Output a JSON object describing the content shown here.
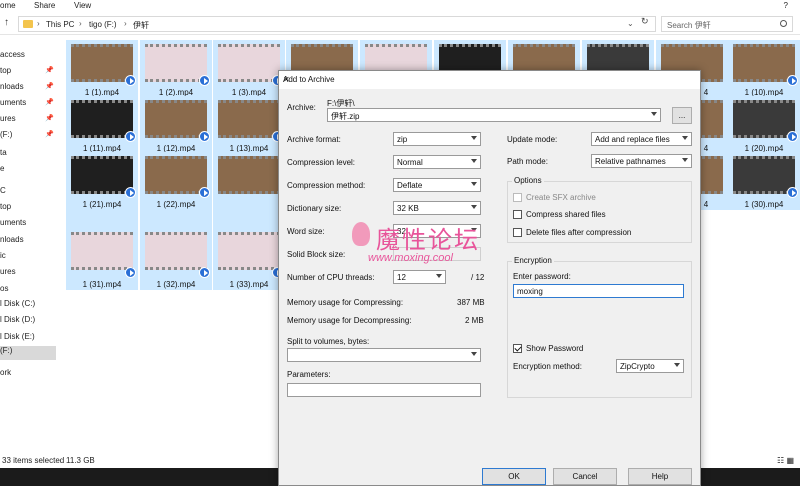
{
  "ribbon": {
    "tabs": [
      "ome",
      "Share",
      "View"
    ]
  },
  "address": {
    "crumbs": [
      "This PC",
      "tigo (F:)",
      "伊轩"
    ],
    "search_placeholder": "Search 伊轩"
  },
  "sidebar": {
    "items": [
      {
        "label": "access",
        "pinned": false
      },
      {
        "label": "top",
        "pinned": true
      },
      {
        "label": "nloads",
        "pinned": true
      },
      {
        "label": "uments",
        "pinned": true
      },
      {
        "label": "ures",
        "pinned": true
      },
      {
        "label": "(F:)",
        "pinned": true
      },
      {
        "label": "ta",
        "pinned": false
      },
      {
        "label": "e",
        "pinned": false
      },
      {
        "label": "C",
        "pinned": false
      },
      {
        "label": "top",
        "pinned": false
      },
      {
        "label": "uments",
        "pinned": false
      },
      {
        "label": "nloads",
        "pinned": false
      },
      {
        "label": "ic",
        "pinned": false
      },
      {
        "label": "ures",
        "pinned": false
      },
      {
        "label": "os",
        "pinned": false
      },
      {
        "label": "l Disk (C:)",
        "pinned": false
      },
      {
        "label": "l Disk (D:)",
        "pinned": false
      },
      {
        "label": "l Disk (E:)",
        "pinned": false
      },
      {
        "label": "(F:)",
        "pinned": false,
        "selected": true
      },
      {
        "label": "ork",
        "pinned": false
      }
    ]
  },
  "files": [
    {
      "name": "1 (1).mp4"
    },
    {
      "name": "1 (2).mp4"
    },
    {
      "name": "1 (3).mp4"
    },
    {
      "name": "1 (10).mp4"
    },
    {
      "name": "1 (11).mp4"
    },
    {
      "name": "1 (12).mp4"
    },
    {
      "name": "1 (13).mp4"
    },
    {
      "name": "1 (20).mp4"
    },
    {
      "name": "1 (21).mp4"
    },
    {
      "name": "1 (22).mp4"
    },
    {
      "name": "1 (30).mp4"
    },
    {
      "name": "1 (31).mp4"
    },
    {
      "name": "1 (32).mp4"
    },
    {
      "name": "1 (33).mp4"
    },
    {
      "name": "4"
    },
    {
      "name": "4"
    },
    {
      "name": "4"
    }
  ],
  "status": {
    "selection": "33 items selected",
    "size": "11.3 GB"
  },
  "dialog": {
    "title": "Add to Archive",
    "archive_label": "Archive:",
    "archive_path": "F:\\伊轩\\",
    "archive_name": "伊轩.zip",
    "browse_label": "...",
    "left_fields": [
      {
        "label": "Archive format:",
        "value": "zip"
      },
      {
        "label": "Compression level:",
        "value": "Normal"
      },
      {
        "label": "Compression method:",
        "value": "Deflate"
      },
      {
        "label": "Dictionary size:",
        "value": "32 KB"
      },
      {
        "label": "Word size:",
        "value": "32"
      },
      {
        "label": "Solid Block size:",
        "value": ""
      }
    ],
    "threads_label": "Number of CPU threads:",
    "threads_value": "12",
    "threads_max": "/ 12",
    "mem_compress_label": "Memory usage for Compressing:",
    "mem_compress_value": "387 MB",
    "mem_decompress_label": "Memory usage for Decompressing:",
    "mem_decompress_value": "2 MB",
    "split_label": "Split to volumes, bytes:",
    "split_value": "",
    "params_label": "Parameters:",
    "params_value": "",
    "update_mode_label": "Update mode:",
    "update_mode_value": "Add and replace files",
    "path_mode_label": "Path mode:",
    "path_mode_value": "Relative pathnames",
    "options_title": "Options",
    "opt_sfx": "Create SFX archive",
    "opt_shared": "Compress shared files",
    "opt_delete": "Delete files after compression",
    "encryption_title": "Encryption",
    "password_label": "Enter password:",
    "password_value": "moxing",
    "show_password": "Show Password",
    "enc_method_label": "Encryption method:",
    "enc_method_value": "ZipCrypto",
    "ok": "OK",
    "cancel": "Cancel",
    "help": "Help"
  },
  "watermark": {
    "title": "魔性论坛",
    "url": "www.moxing.cool"
  }
}
